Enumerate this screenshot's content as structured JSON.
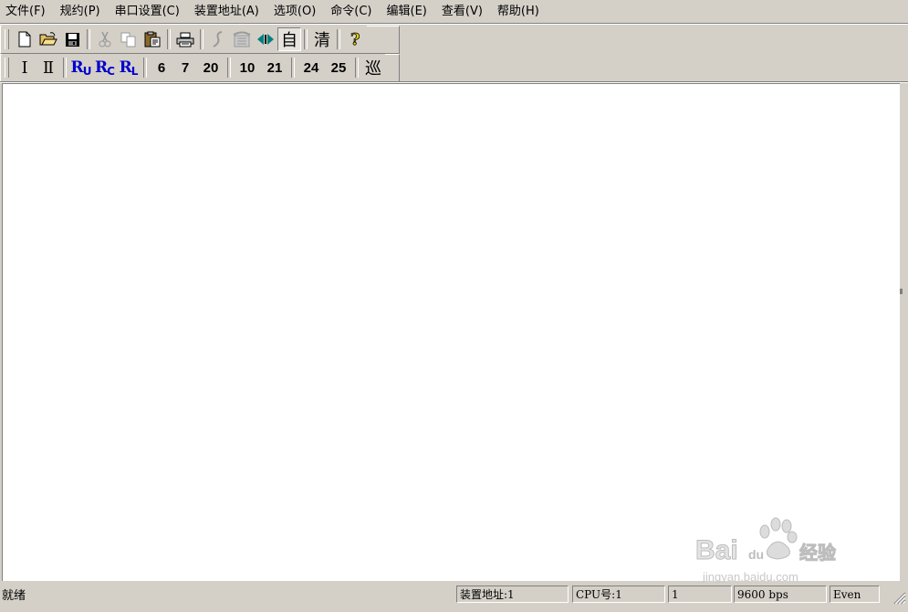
{
  "menu": [
    "文件(F)",
    "规约(P)",
    "串口设置(C)",
    "装置地址(A)",
    "选项(O)",
    "命令(C)",
    "编辑(E)",
    "查看(V)",
    "帮助(H)"
  ],
  "toolbar1": {
    "new_icon": "new-file-icon",
    "open_icon": "open-folder-icon",
    "save_icon": "save-disk-icon",
    "cut_icon": "scissors-icon",
    "copy_icon": "copy-icon",
    "paste_icon": "paste-clipboard-icon",
    "print_icon": "printer-icon",
    "hangup_icon": "hangup-icon",
    "phone_icon": "phone-icon",
    "connect_icon": "connect-icon",
    "auto_label": "自",
    "clear_label": "清",
    "help_icon": "help-question-icon"
  },
  "toolbar2": {
    "roman1": "Ⅰ",
    "roman2": "Ⅱ",
    "ru": {
      "r": "R",
      "sub": "U"
    },
    "rc": {
      "r": "R",
      "sub": "C"
    },
    "rl": {
      "r": "R",
      "sub": "L"
    },
    "nums": [
      "6",
      "7",
      "20",
      "10",
      "21",
      "24",
      "25"
    ],
    "patrol_label": "巡"
  },
  "status": {
    "text": "就绪",
    "device_address": "装置地址:1",
    "cpu": "CPU号:1",
    "index": "1",
    "baud": "9600 bps",
    "parity": "Even"
  },
  "watermark": {
    "brand": "Bai  du 经验",
    "url": "jingyan.baidu.com"
  },
  "colors": {
    "chrome": "#d4d0c8",
    "workspace": "#ffffff",
    "accent_blue": "#0000cc",
    "teal": "#008080"
  }
}
